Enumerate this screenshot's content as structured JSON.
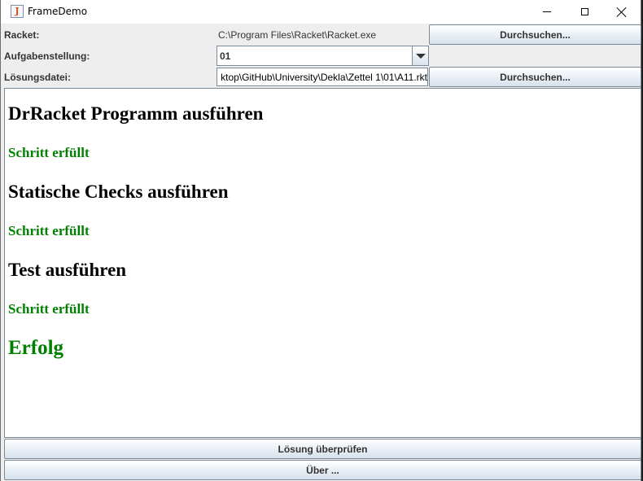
{
  "window": {
    "title": "FrameDemo",
    "icon": "java-cup-icon"
  },
  "form": {
    "racket_label": "Racket:",
    "racket_path": "C:\\Program Files\\Racket\\Racket.exe",
    "browse_label": "Durchsuchen...",
    "task_label": "Aufgabenstellung:",
    "task_value": "01",
    "solution_label": "Lösungsdatei:",
    "solution_path": "ktop\\GitHub\\University\\Dekla\\Zettel 1\\01\\A11.rkt",
    "browse_solution_label": "Durchsuchen..."
  },
  "output": {
    "steps": [
      {
        "heading": "DrRacket Programm ausführen",
        "status": "Schritt erfüllt"
      },
      {
        "heading": "Statische Checks ausführen",
        "status": "Schritt erfüllt"
      },
      {
        "heading": "Test ausführen",
        "status": "Schritt erfüllt"
      }
    ],
    "result": "Erfolg"
  },
  "buttons": {
    "check": "Lösung überprüfen",
    "about": "Über ..."
  },
  "colors": {
    "success_green": "#008000",
    "window_background": "#eeeeee",
    "output_background": "#ffffff"
  }
}
